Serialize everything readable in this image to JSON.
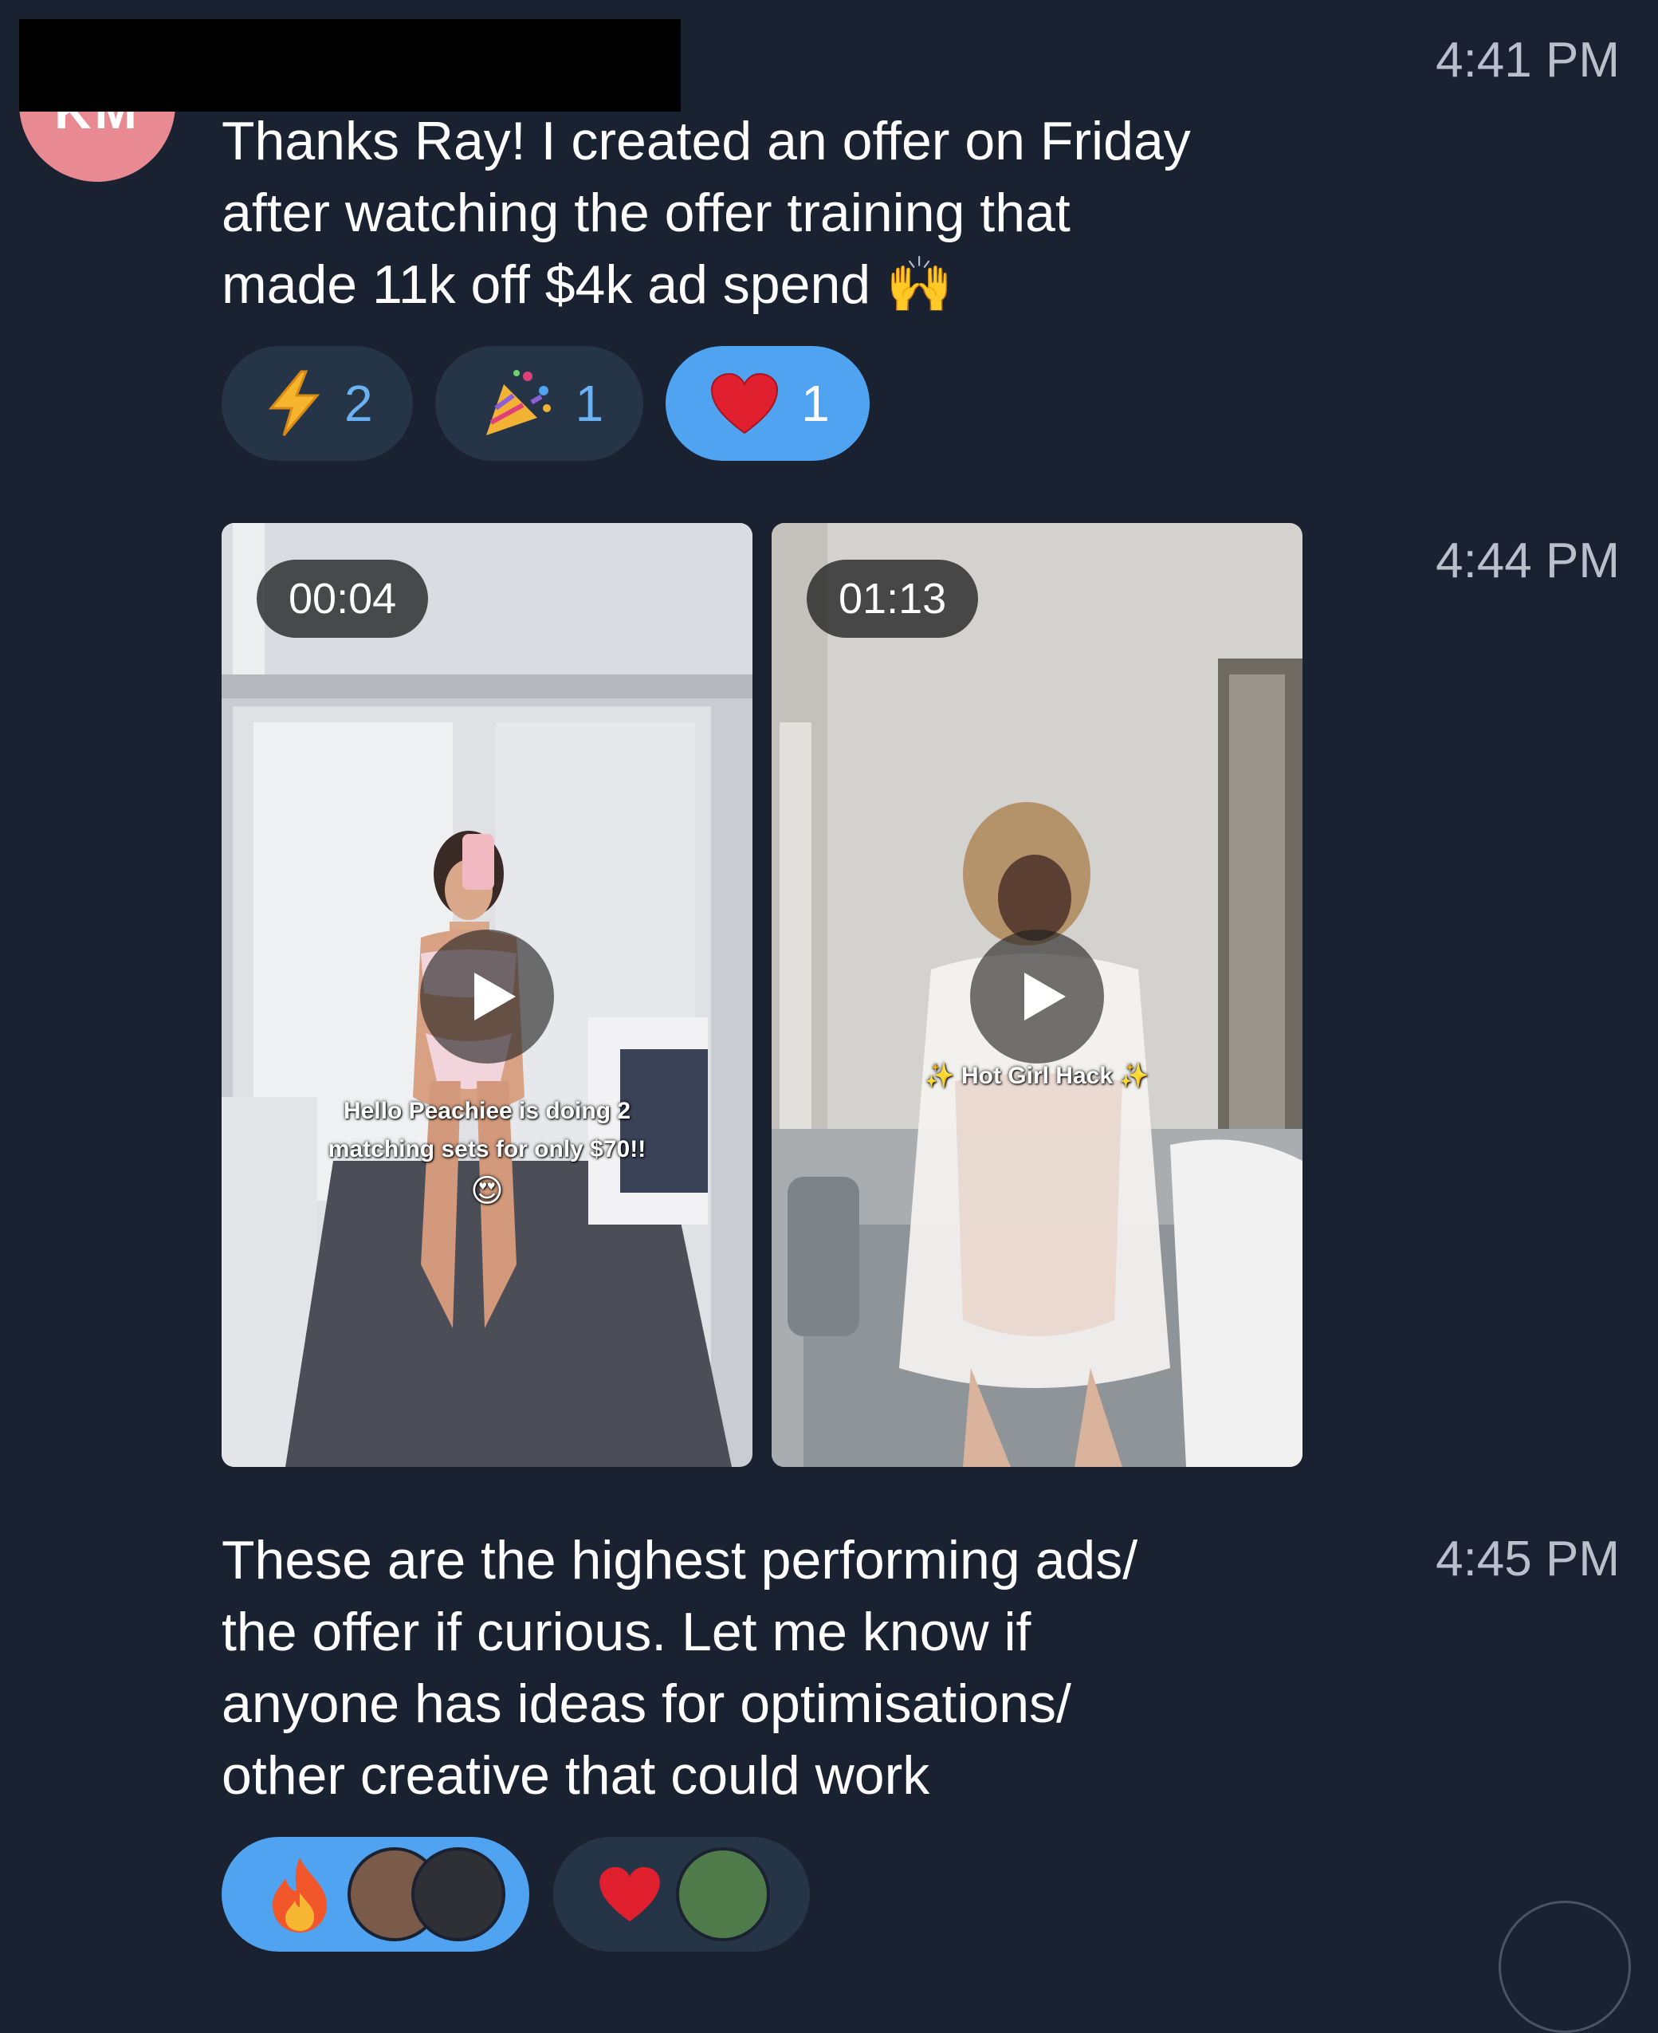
{
  "avatar": {
    "initials": "KM"
  },
  "messages": [
    {
      "time": "4:41 PM",
      "text": "Thanks Ray! I created an offer on Friday\nafter watching the offer training that\nmade 11k off $4k ad spend 🙌",
      "reactions": [
        {
          "icon": "lightning-icon",
          "count": "2",
          "active": false
        },
        {
          "icon": "party-popper-icon",
          "count": "1",
          "active": false
        },
        {
          "icon": "heart-icon",
          "count": "1",
          "active": true
        }
      ]
    },
    {
      "time": "4:44 PM",
      "videos": [
        {
          "duration": "00:04",
          "caption": "Hello Peachiee is doing 2\nmatching sets for only $70!!",
          "emoji": "😍"
        },
        {
          "duration": "01:13",
          "caption": "✨ Hot Girl Hack ✨"
        }
      ]
    },
    {
      "time": "4:45 PM",
      "text": "These are the highest performing ads/\nthe offer if curious. Let me know if\nanyone has ideas for optimisations/\nother creative that could work",
      "reactions": [
        {
          "icon": "fire-icon",
          "active": true
        },
        {
          "icon": "heart-icon",
          "active": false
        }
      ]
    }
  ],
  "colors": {
    "background": "#1a2130",
    "reaction_active": "#4fa3f0",
    "reaction_inactive": "#263448",
    "reaction_count": "#6cb2f2",
    "timestamp": "#b9c0cc"
  }
}
